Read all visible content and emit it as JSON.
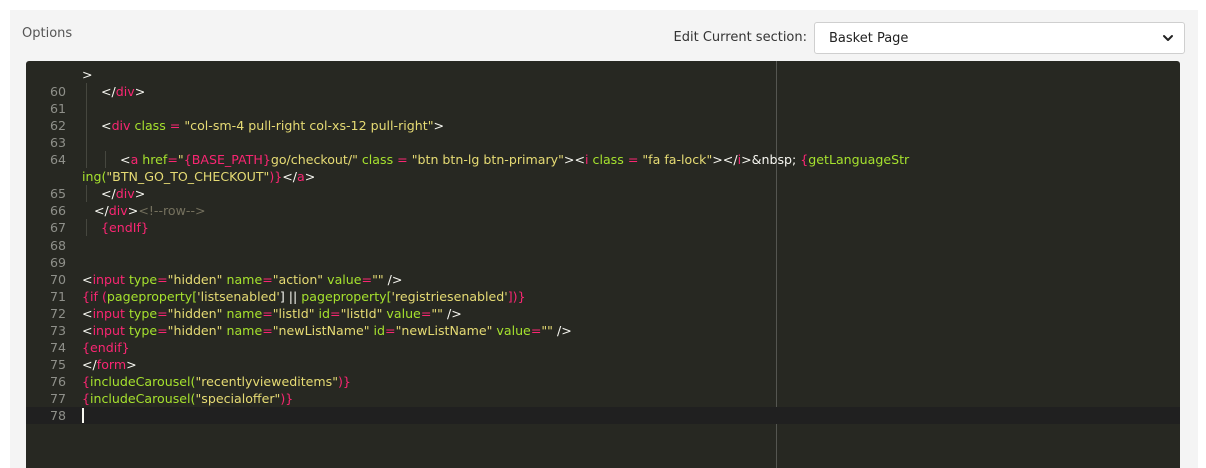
{
  "header": {
    "options_label": "Options",
    "section_label": "Edit Current section:",
    "section_value": "Basket Page",
    "section_select_icon": "chevron-down-icon"
  },
  "editor": {
    "colors": {
      "background": "#272822",
      "tag": "#f92672",
      "attribute": "#a6e22e",
      "string": "#e6db74",
      "comment": "#75715e",
      "text": "#f8f8f2",
      "gutter": "#8f908a"
    },
    "cursor_line": "78",
    "lines": [
      {
        "num": "",
        "indent": 0,
        "tokens": [
          {
            "t": ">",
            "c": "p"
          }
        ]
      },
      {
        "num": "60",
        "indent": 1,
        "tokens": [
          {
            "t": "</",
            "c": "p"
          },
          {
            "t": "div",
            "c": "t"
          },
          {
            "t": ">",
            "c": "p"
          }
        ]
      },
      {
        "num": "61",
        "indent": 1,
        "tokens": []
      },
      {
        "num": "62",
        "indent": 1,
        "tokens": [
          {
            "t": "<",
            "c": "p"
          },
          {
            "t": "div",
            "c": "t"
          },
          {
            "t": " class",
            "c": "a"
          },
          {
            "t": " = ",
            "c": "t"
          },
          {
            "t": "\"col-sm-4 pull-right col-xs-12 pull-right\"",
            "c": "s"
          },
          {
            "t": ">",
            "c": "p"
          }
        ]
      },
      {
        "num": "63",
        "indent": 1,
        "tokens": []
      },
      {
        "num": "64",
        "indent": 2,
        "tokens": [
          {
            "t": "<",
            "c": "p"
          },
          {
            "t": "a",
            "c": "t"
          },
          {
            "t": " href",
            "c": "a"
          },
          {
            "t": "=",
            "c": "t"
          },
          {
            "t": "\"",
            "c": "s"
          },
          {
            "t": "{BASE_PATH}",
            "c": "t"
          },
          {
            "t": "go/checkout/\"",
            "c": "s"
          },
          {
            "t": " class",
            "c": "a"
          },
          {
            "t": " = ",
            "c": "t"
          },
          {
            "t": "\"btn btn-lg btn-primary\"",
            "c": "s"
          },
          {
            "t": "><",
            "c": "p"
          },
          {
            "t": "i",
            "c": "t"
          },
          {
            "t": " class",
            "c": "a"
          },
          {
            "t": " = ",
            "c": "t"
          },
          {
            "t": "\"fa fa-lock\"",
            "c": "s"
          },
          {
            "t": "></",
            "c": "p"
          },
          {
            "t": "i",
            "c": "t"
          },
          {
            "t": ">&nbsp; ",
            "c": "p"
          },
          {
            "t": "{",
            "c": "t"
          },
          {
            "t": "getLanguageStr",
            "c": "a"
          }
        ]
      },
      {
        "num": "",
        "indent": 0,
        "tokens": [
          {
            "t": "ing(",
            "c": "a"
          },
          {
            "t": "\"BTN_GO_TO_CHECKOUT\"",
            "c": "s"
          },
          {
            "t": ")}",
            "c": "t"
          },
          {
            "t": "</",
            "c": "p"
          },
          {
            "t": "a",
            "c": "t"
          },
          {
            "t": ">",
            "c": "p"
          }
        ]
      },
      {
        "num": "65",
        "indent": 1,
        "tokens": [
          {
            "t": "</",
            "c": "p"
          },
          {
            "t": "div",
            "c": "t"
          },
          {
            "t": ">",
            "c": "p"
          }
        ]
      },
      {
        "num": "66",
        "indent": 0,
        "lead": "  ",
        "tokens": [
          {
            "t": "</",
            "c": "p"
          },
          {
            "t": "div",
            "c": "t"
          },
          {
            "t": ">",
            "c": "p"
          },
          {
            "t": "<!--row-->",
            "c": "c"
          }
        ]
      },
      {
        "num": "67",
        "indent": 1,
        "tokens": [
          {
            "t": "{endIf}",
            "c": "t"
          }
        ]
      },
      {
        "num": "68",
        "indent": 0,
        "tokens": []
      },
      {
        "num": "69",
        "indent": 0,
        "tokens": []
      },
      {
        "num": "70",
        "indent": 0,
        "tokens": [
          {
            "t": "<",
            "c": "p"
          },
          {
            "t": "input",
            "c": "t"
          },
          {
            "t": " type",
            "c": "a"
          },
          {
            "t": "=",
            "c": "t"
          },
          {
            "t": "\"hidden\"",
            "c": "s"
          },
          {
            "t": " name",
            "c": "a"
          },
          {
            "t": "=",
            "c": "t"
          },
          {
            "t": "\"action\"",
            "c": "s"
          },
          {
            "t": " value",
            "c": "a"
          },
          {
            "t": "=",
            "c": "t"
          },
          {
            "t": "\"\"",
            "c": "s"
          },
          {
            "t": " />",
            "c": "p"
          }
        ]
      },
      {
        "num": "71",
        "indent": 0,
        "tokens": [
          {
            "t": "{if (",
            "c": "t"
          },
          {
            "t": "pageproperty[",
            "c": "a"
          },
          {
            "t": "'listsenabled'",
            "c": "s"
          },
          {
            "t": "] || ",
            "c": "p"
          },
          {
            "t": "pageproperty[",
            "c": "a"
          },
          {
            "t": "'registriesenabled'",
            "c": "s"
          },
          {
            "t": "])}",
            "c": "t"
          }
        ]
      },
      {
        "num": "72",
        "indent": 0,
        "tokens": [
          {
            "t": "<",
            "c": "p"
          },
          {
            "t": "input",
            "c": "t"
          },
          {
            "t": " type",
            "c": "a"
          },
          {
            "t": "=",
            "c": "t"
          },
          {
            "t": "\"hidden\"",
            "c": "s"
          },
          {
            "t": " name",
            "c": "a"
          },
          {
            "t": "=",
            "c": "t"
          },
          {
            "t": "\"listId\"",
            "c": "s"
          },
          {
            "t": " id",
            "c": "a"
          },
          {
            "t": "=",
            "c": "t"
          },
          {
            "t": "\"listId\"",
            "c": "s"
          },
          {
            "t": " value",
            "c": "a"
          },
          {
            "t": "=",
            "c": "t"
          },
          {
            "t": "\"\"",
            "c": "s"
          },
          {
            "t": " />",
            "c": "p"
          }
        ]
      },
      {
        "num": "73",
        "indent": 0,
        "tokens": [
          {
            "t": "<",
            "c": "p"
          },
          {
            "t": "input",
            "c": "t"
          },
          {
            "t": " type",
            "c": "a"
          },
          {
            "t": "=",
            "c": "t"
          },
          {
            "t": "\"hidden\"",
            "c": "s"
          },
          {
            "t": " name",
            "c": "a"
          },
          {
            "t": "=",
            "c": "t"
          },
          {
            "t": "\"newListName\"",
            "c": "s"
          },
          {
            "t": " id",
            "c": "a"
          },
          {
            "t": "=",
            "c": "t"
          },
          {
            "t": "\"newListName\"",
            "c": "s"
          },
          {
            "t": " value",
            "c": "a"
          },
          {
            "t": "=",
            "c": "t"
          },
          {
            "t": "\"\"",
            "c": "s"
          },
          {
            "t": " />",
            "c": "p"
          }
        ]
      },
      {
        "num": "74",
        "indent": 0,
        "tokens": [
          {
            "t": "{endif}",
            "c": "t"
          }
        ]
      },
      {
        "num": "75",
        "indent": 0,
        "tokens": [
          {
            "t": "</",
            "c": "p"
          },
          {
            "t": "form",
            "c": "t"
          },
          {
            "t": ">",
            "c": "p"
          }
        ]
      },
      {
        "num": "76",
        "indent": 0,
        "tokens": [
          {
            "t": "{",
            "c": "t"
          },
          {
            "t": "includeCarousel(",
            "c": "a"
          },
          {
            "t": "\"recentlyvieweditems\"",
            "c": "s"
          },
          {
            "t": ")}",
            "c": "t"
          }
        ]
      },
      {
        "num": "77",
        "indent": 0,
        "tokens": [
          {
            "t": "{",
            "c": "t"
          },
          {
            "t": "includeCarousel(",
            "c": "a"
          },
          {
            "t": "\"specialoffer\"",
            "c": "s"
          },
          {
            "t": ")}",
            "c": "t"
          }
        ]
      },
      {
        "num": "78",
        "indent": 0,
        "tokens": []
      }
    ]
  }
}
